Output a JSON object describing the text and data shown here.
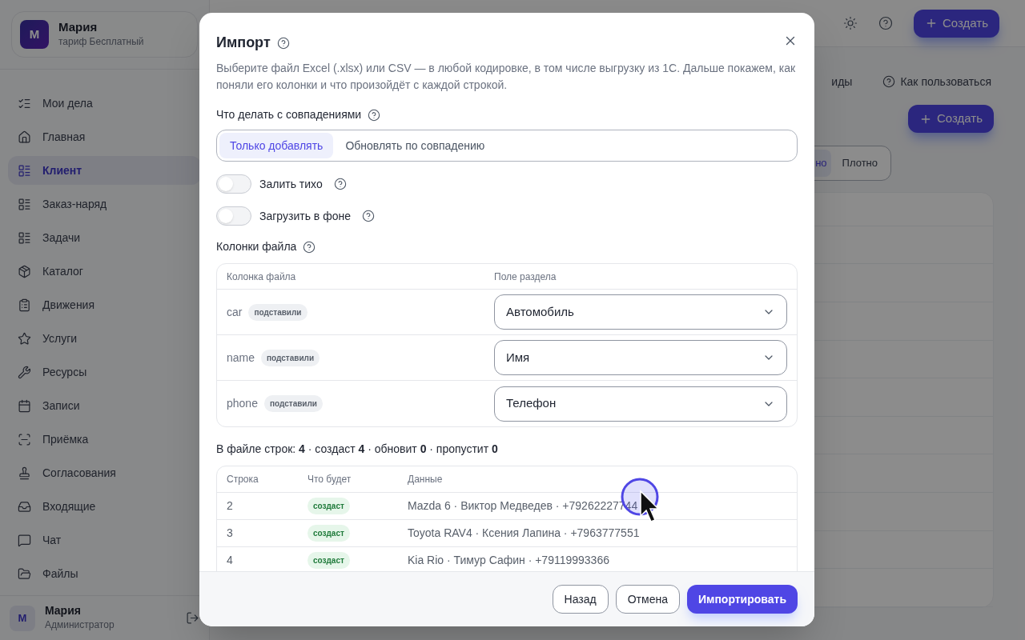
{
  "sidebar": {
    "profile": {
      "initial": "М",
      "name": "Мария",
      "plan": "тариф Бесплатный"
    },
    "items": [
      {
        "label": "Мои дела",
        "selected": false
      },
      {
        "label": "Главная",
        "selected": false
      },
      {
        "label": "Клиент",
        "selected": true
      },
      {
        "label": "Заказ-наряд",
        "selected": false
      },
      {
        "label": "Задачи",
        "selected": false
      },
      {
        "label": "Каталог",
        "selected": false
      },
      {
        "label": "Движения",
        "selected": false
      },
      {
        "label": "Услуги",
        "selected": false
      },
      {
        "label": "Ресурсы",
        "selected": false
      },
      {
        "label": "Записи",
        "selected": false
      },
      {
        "label": "Приёмка",
        "selected": false
      },
      {
        "label": "Согласования",
        "selected": false
      },
      {
        "label": "Входящие",
        "selected": false
      },
      {
        "label": "Чат",
        "selected": false
      },
      {
        "label": "Файлы",
        "selected": false
      }
    ],
    "user": {
      "initial": "М",
      "name": "Мария",
      "role": "Администратор"
    }
  },
  "header": {
    "create_button": "Создать"
  },
  "page": {
    "cut_link": "иды",
    "help_link": "Как пользоваться",
    "create_button": "Создать",
    "density": [
      {
        "label": "но",
        "selected": true
      },
      {
        "label": "Плотно",
        "selected": false
      }
    ]
  },
  "dialog": {
    "title": "Импорт",
    "description": "Выберите файл Excel (.xlsx) или CSV — в любой кодировке, в том числе выгрузку из 1С. Дальше покажем, как поняли его колонки и что произойдёт с каждой строкой.",
    "match_mode": {
      "label": "Что делать с совпадениями",
      "options": [
        {
          "label": "Только добавлять",
          "selected": true
        },
        {
          "label": "Обновлять по совпадению",
          "selected": false
        }
      ]
    },
    "toggles": [
      {
        "label": "Залить тихо",
        "on": false
      },
      {
        "label": "Загрузить в фоне",
        "on": false
      }
    ],
    "columns": {
      "label": "Колонки файла",
      "headers": [
        "Колонка файла",
        "Поле раздела"
      ],
      "rows": [
        {
          "file_column": "car",
          "badge": "подставили",
          "field": "Автомобиль"
        },
        {
          "file_column": "name",
          "badge": "подставили",
          "field": "Имя"
        },
        {
          "file_column": "phone",
          "badge": "подставили",
          "field": "Телефон"
        }
      ]
    },
    "summary": "В файле строк: **4** · создаст **4** · обновит **0** · пропустит **0**",
    "preview": {
      "headers": [
        "Строка",
        "Что будет",
        "Данные"
      ],
      "rows": [
        {
          "row": "2",
          "action": "создаст",
          "kind": "create",
          "data": "Mazda 6 · Виктор Медведев · +79262227744"
        },
        {
          "row": "3",
          "action": "создаст",
          "kind": "create",
          "data": "Toyota RAV4 · Ксения Лапина · +7963777551"
        },
        {
          "row": "4",
          "action": "создаст",
          "kind": "create",
          "data": "Kia Rio · Тимур Сафин · +79119993366"
        }
      ]
    },
    "buttons": [
      {
        "label": "Назад",
        "kind": "secondary"
      },
      {
        "label": "Отмена",
        "kind": "secondary"
      },
      {
        "label": "Импортировать",
        "kind": "primary"
      }
    ]
  }
}
